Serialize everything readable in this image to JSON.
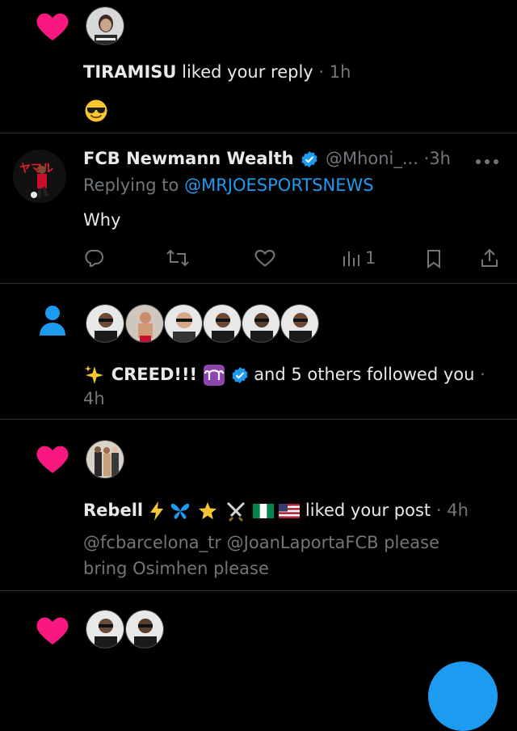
{
  "notifications": [
    {
      "type": "like",
      "text": "TIRAMISU liked your reply",
      "user": "TIRAMISU",
      "action": "liked your reply",
      "time": "1h",
      "content_emoji": "smiling-face-with-sunglasses"
    },
    {
      "type": "reply",
      "display_name": "FCB Newmann Wealth",
      "handle": "@Mhoni_...",
      "time": "3h",
      "replying_prefix": "Replying to",
      "replying_to": "@MRJOESPORTSNEWS",
      "body": "Why",
      "views": "1"
    },
    {
      "type": "follow",
      "name": "CREED!!!",
      "rest": "and 5 others followed you",
      "time": "4h"
    },
    {
      "type": "like",
      "user": "Rebell",
      "action": "liked your post",
      "time": "4h",
      "quote": "@fcbarcelona_tr @JoanLaportaFCB please bring Osimhen please",
      "quote_line1": "@fcbarcelona_tr @JoanLaportaFCB please",
      "quote_line2": "bring Osimhen please"
    }
  ],
  "colors": {
    "heart": "#f91880",
    "accent": "#1d9bf0",
    "muted": "#71767b",
    "text": "#e7e9ea"
  }
}
